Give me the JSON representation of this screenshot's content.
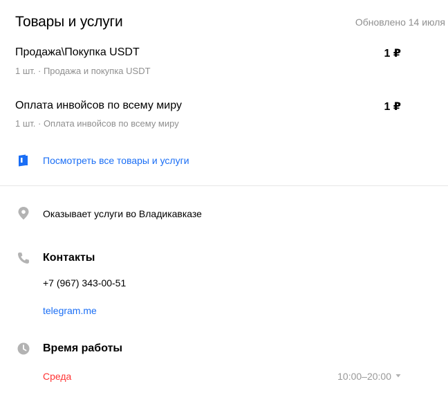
{
  "goods": {
    "title": "Товары и услуги",
    "updated": "Обновлено 14 июля",
    "items": [
      {
        "name": "Продажа\\Покупка USDT",
        "subtitle": "1 шт. · Продажа и покупка USDT",
        "price": "1 ₽"
      },
      {
        "name": "Оплата инвойсов по всему миру",
        "subtitle": "1 шт. · Оплата инвойсов по всему миру",
        "price": "1 ₽"
      }
    ],
    "see_all": "Посмотреть все товары и услуги"
  },
  "location": {
    "text": "Оказывает услуги во Владикавказе"
  },
  "contacts": {
    "title": "Контакты",
    "phone": "+7 (967) 343-00-51",
    "link": "telegram.me"
  },
  "hours": {
    "title": "Время работы",
    "today": "Среда",
    "time": "10:00–20:00"
  },
  "colors": {
    "link": "#1a6ef5",
    "today": "#ff3333",
    "muted": "#8f8f8f"
  },
  "icons": [
    "book-icon",
    "map-pin-icon",
    "phone-icon",
    "clock-icon",
    "chevron-down-icon"
  ]
}
